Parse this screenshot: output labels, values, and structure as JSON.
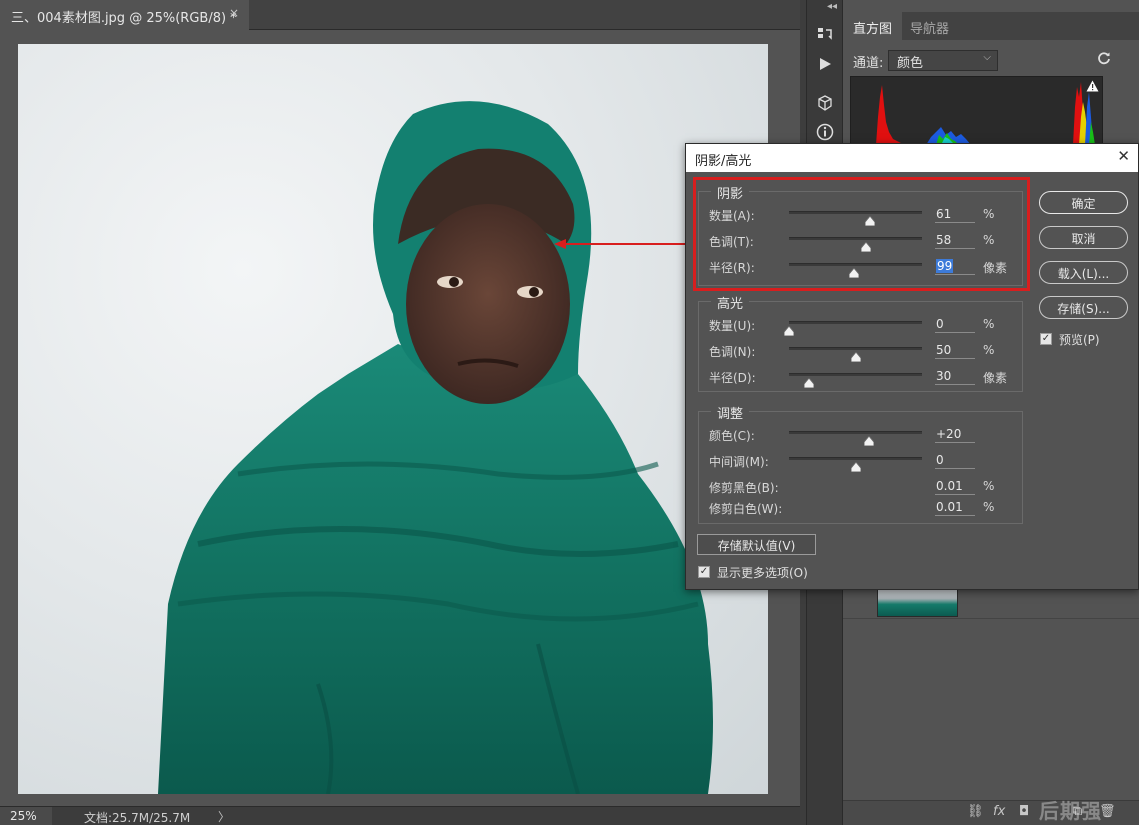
{
  "document": {
    "tab_title": "三、004素材图.jpg @ 25%(RGB/8) *",
    "close_glyph": "×"
  },
  "statusbar": {
    "zoom": "25%",
    "doc_info": "文档:25.7M/25.7M",
    "arrow": "〉"
  },
  "panel": {
    "tabs": [
      "直方图",
      "导航器"
    ],
    "channel_label": "通道:",
    "channel_value": "颜色"
  },
  "dialog": {
    "title": "阴影/高光",
    "shadows": {
      "title": "阴影",
      "rows": [
        {
          "label": "数量(A):",
          "value": "61",
          "unit": "%",
          "level": 61
        },
        {
          "label": "色调(T):",
          "value": "58",
          "unit": "%",
          "level": 58
        },
        {
          "label": "半径(R):",
          "value": "99",
          "unit": "像素",
          "level": 49
        }
      ]
    },
    "highlights": {
      "title": "高光",
      "rows": [
        {
          "label": "数量(U):",
          "value": "0",
          "unit": "%",
          "level": 0
        },
        {
          "label": "色调(N):",
          "value": "50",
          "unit": "%",
          "level": 50
        },
        {
          "label": "半径(D):",
          "value": "30",
          "unit": "像素",
          "level": 15
        }
      ]
    },
    "adjustments": {
      "title": "调整",
      "rows": [
        {
          "label": "颜色(C):",
          "value": "+20",
          "unit": "",
          "level": 60
        },
        {
          "label": "中间调(M):",
          "value": "0",
          "unit": "",
          "level": 50
        },
        {
          "label": "修剪黑色(B):",
          "value": "0.01",
          "unit": "%"
        },
        {
          "label": "修剪白色(W):",
          "value": "0.01",
          "unit": "%"
        }
      ]
    },
    "buttons": {
      "ok": "确定",
      "cancel": "取消",
      "load": "载入(L)...",
      "save": "存储(S)..."
    },
    "preview_label": "预览(P)",
    "preview_checked": true,
    "save_defaults": "存储默认值(V)",
    "more_options_label": "显示更多选项(O)",
    "more_options_checked": true
  },
  "watermark": "后期强",
  "colors": {
    "highlight_red": "#d81e1e",
    "photo_teal": "#157a6a",
    "selection_blue": "#3d7bd9"
  }
}
